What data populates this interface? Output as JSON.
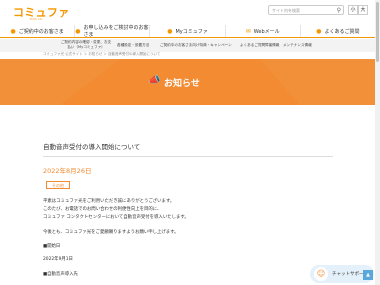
{
  "header": {
    "logo": "コミュファ",
    "logo_sub": "from ctc",
    "search_placeholder": "サイト内を検索",
    "font_small": "小",
    "font_large": "大"
  },
  "nav": [
    {
      "label": "ご契約中のお客さま"
    },
    {
      "label": "お申し込みをご検討中のお客さま"
    },
    {
      "label": "Myコミュファ"
    },
    {
      "label": "Webメール"
    },
    {
      "label": "よくあるご質問"
    }
  ],
  "subnav": [
    "ご契約内容の確認・変更、お支払い（Myコミュファ）",
    "各種設定・設置方法",
    "ご契約中のお客さま向け特典・キャンペーン",
    "よくあるご質問",
    "障害情報",
    "メンテナンス情報"
  ],
  "breadcrumb": "コミュファ光 公式サイト ＞ お知らせ ＞ 自動音声受付の導入開始について",
  "banner_title": "お知らせ",
  "article": {
    "title": "自動音声受付の導入開始について",
    "date": "2022年8月26日",
    "badge": "その他",
    "p1": "平素はコミュファ光をご利用いただき誠にありがとうございます。",
    "p2": "このたび、お電話でのお問い合わせの利便性向上を目的に、",
    "p3": "コミュファ コンタクトセンターにおいて自動音声受付を導入いたします。",
    "p4": "今後とも、コミュファ光をご愛顧賜りますようお願い申し上げます。",
    "h1": "■開始日",
    "v1": "2022年9月1日",
    "h2": "■自動音声導入先"
  },
  "chatbot": "チャットサポート"
}
